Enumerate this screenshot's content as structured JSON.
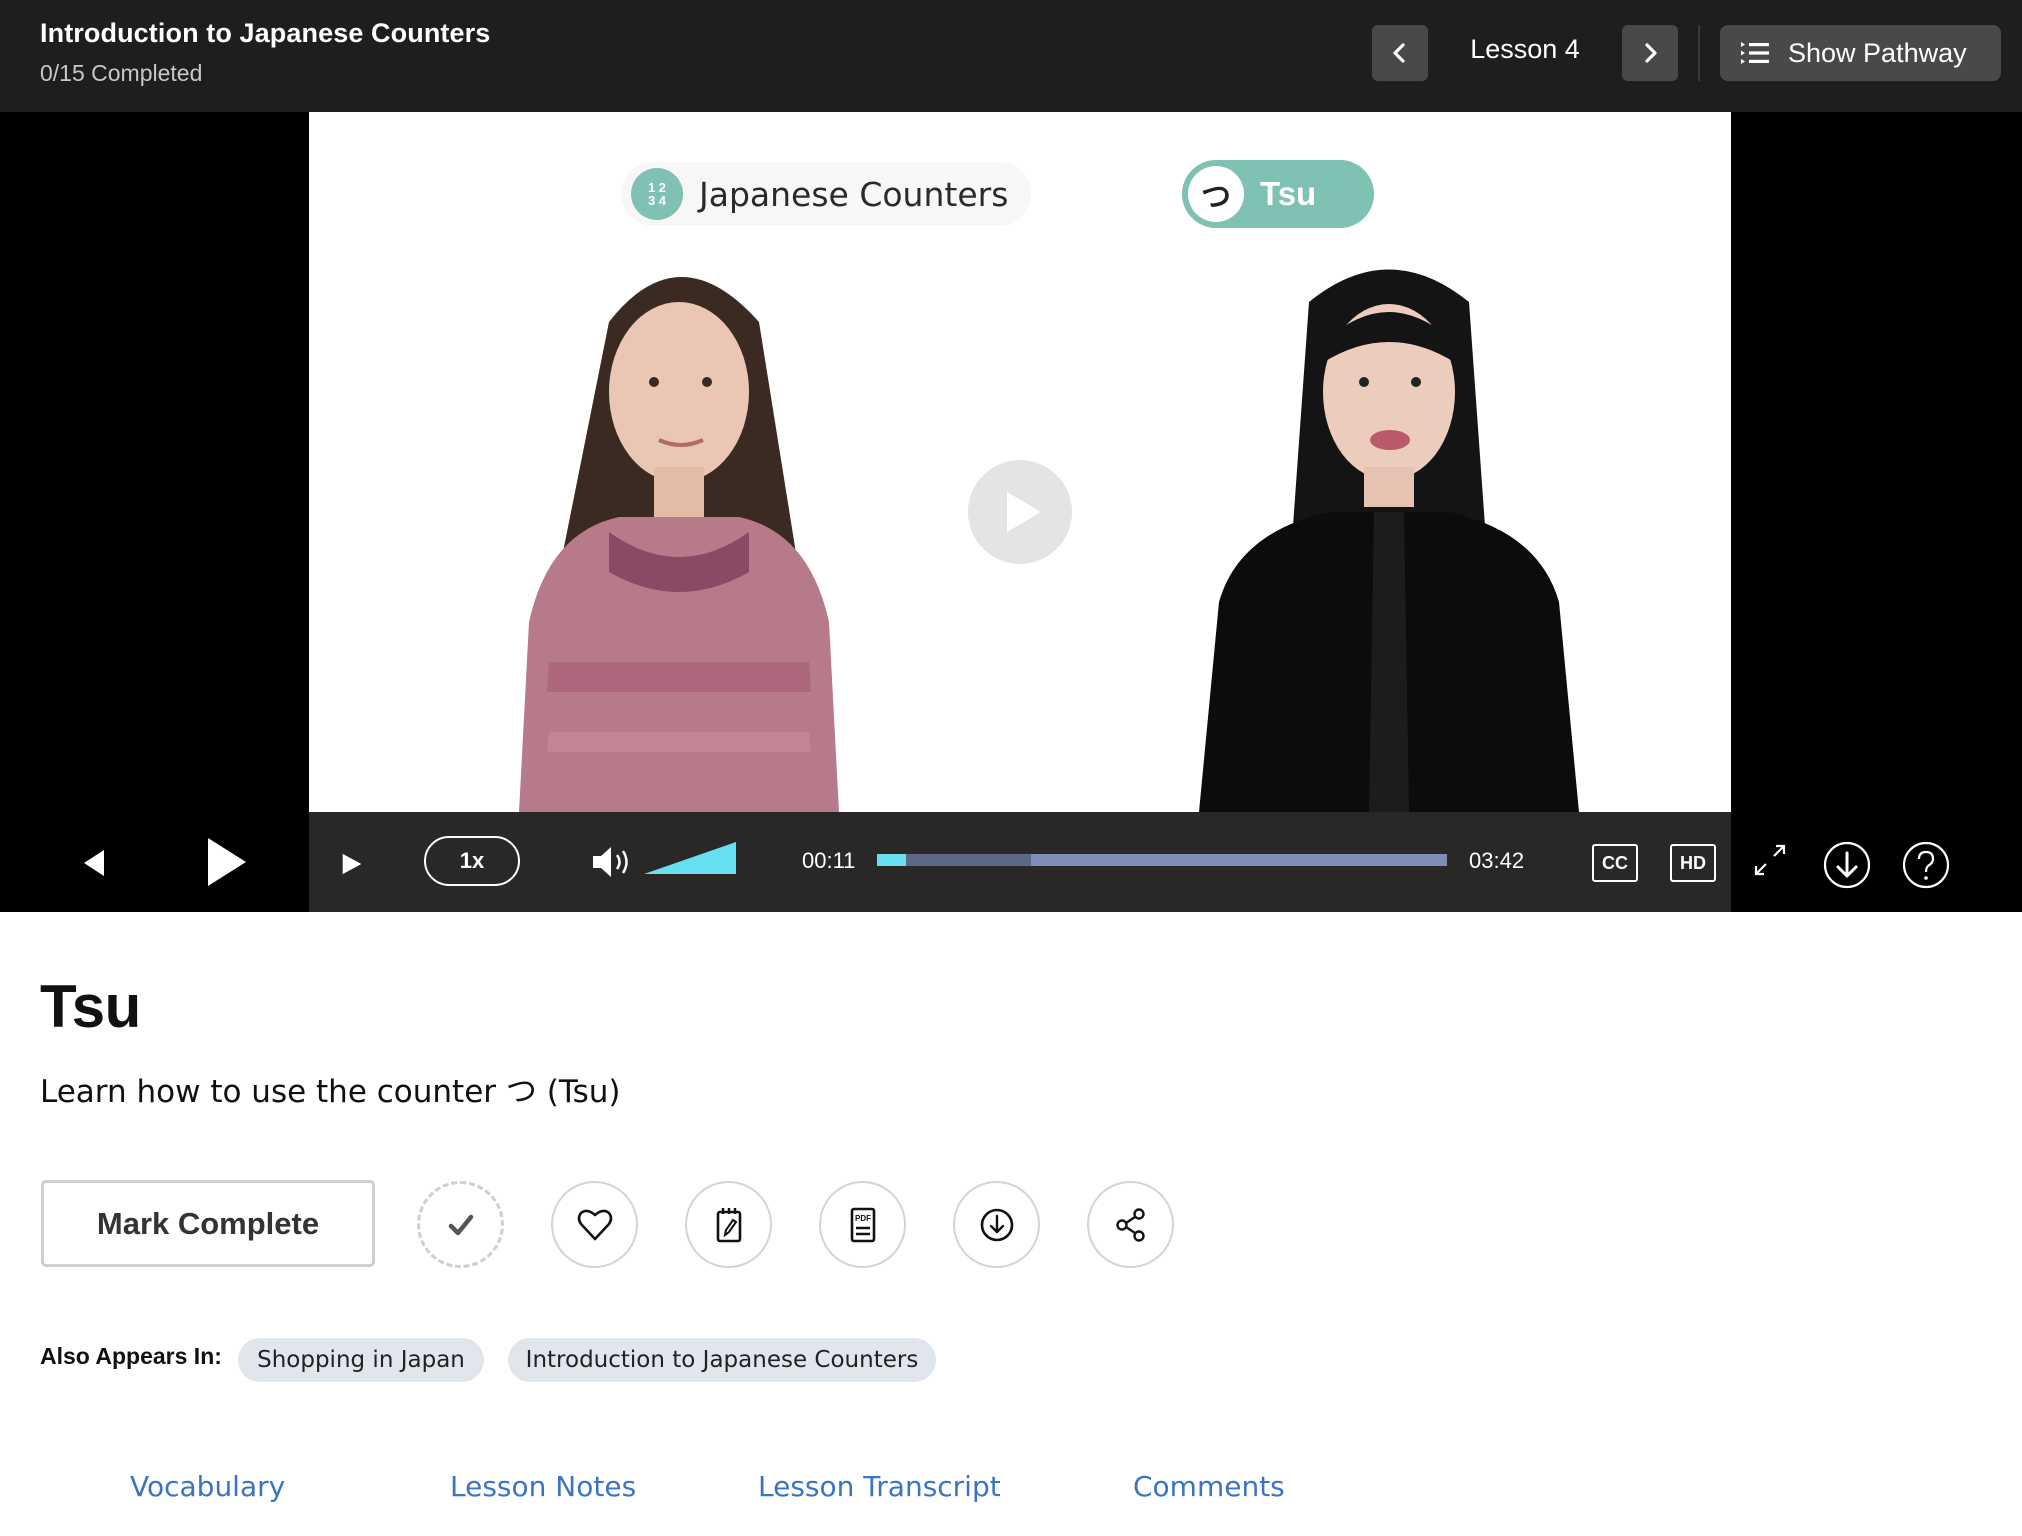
{
  "header": {
    "course_title": "Introduction to Japanese Counters",
    "progress_text": "0/15 Completed",
    "lesson_label": "Lesson 4",
    "prev_icon": "chevron-left-icon",
    "next_icon": "chevron-right-icon",
    "pathway_icon": "list-icon",
    "pathway_label": "Show Pathway"
  },
  "video": {
    "overlay_tag_series": "Japanese Counters",
    "overlay_tag_series_badge": "12 34",
    "overlay_tag_lesson": "Tsu",
    "overlay_tag_lesson_badge": "つ",
    "big_play_icon": "play-icon",
    "controls": {
      "speed": "1x",
      "time_current": "00:11",
      "time_total": "03:42",
      "played_fraction": 0.05,
      "buffered_fraction": 0.27,
      "volume_fraction": 1.0,
      "cc_label": "CC",
      "hd_label": "HD",
      "colors": {
        "played": "#66e0f0",
        "buffered": "#5d6885",
        "track": "#7d8db5",
        "volume": "#66e0f0"
      }
    }
  },
  "lesson": {
    "title": "Tsu",
    "description": "Learn how to use the counter つ (Tsu)",
    "mark_complete_label": "Mark Complete",
    "actions": [
      {
        "icon": "checkmark-icon",
        "label": "completed-status"
      },
      {
        "icon": "heart-icon",
        "label": "favorite"
      },
      {
        "icon": "notepad-icon",
        "label": "notes"
      },
      {
        "icon": "pdf-icon",
        "label": "pdf"
      },
      {
        "icon": "download-icon",
        "label": "download"
      },
      {
        "icon": "share-icon",
        "label": "share"
      }
    ],
    "also_appears_label": "Also Appears In:",
    "also_appears": [
      "Shopping in Japan",
      "Introduction to Japanese Counters"
    ]
  },
  "tabs": [
    "Vocabulary",
    "Lesson Notes",
    "Lesson Transcript",
    "Comments"
  ],
  "colors": {
    "header_bg": "#1e1e20",
    "accent_teal": "#7fc1b3",
    "link_blue": "#3c74c4",
    "chip_bg": "#e1e5ec"
  }
}
